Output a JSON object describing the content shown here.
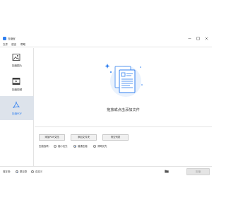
{
  "app": {
    "title": "压缩宝",
    "accent": "#2f7ff0"
  },
  "window_controls": [
    "minimize-icon",
    "maximize-icon",
    "close-icon"
  ],
  "menu": {
    "items": [
      {
        "label": "文件"
      },
      {
        "label": "语言"
      },
      {
        "label": "帮助"
      }
    ]
  },
  "sidebar": {
    "items": [
      {
        "label": "压缩图片",
        "icon": "image-icon",
        "active": false
      },
      {
        "label": "压缩视频",
        "icon": "video-icon",
        "active": false
      },
      {
        "label": "压缩PDF",
        "icon": "pdf-icon",
        "active": true
      }
    ]
  },
  "main": {
    "drop_hint": "拖放或点击添加文件",
    "buttons": {
      "add_pdf": "添加PDF文档",
      "add_folder": "添加文件夹",
      "clear_list": "清空列表"
    },
    "quality": {
      "label": "压缩选项:",
      "options": [
        {
          "label": "缩小优先",
          "checked": false
        },
        {
          "label": "普通压缩",
          "checked": true
        },
        {
          "label": "清晰优先",
          "checked": false
        }
      ]
    }
  },
  "footer": {
    "save_label": "保存到:",
    "options": [
      {
        "label": "原目录",
        "checked": true
      },
      {
        "label": "自定义",
        "checked": false
      }
    ],
    "start_button": "压缩"
  }
}
